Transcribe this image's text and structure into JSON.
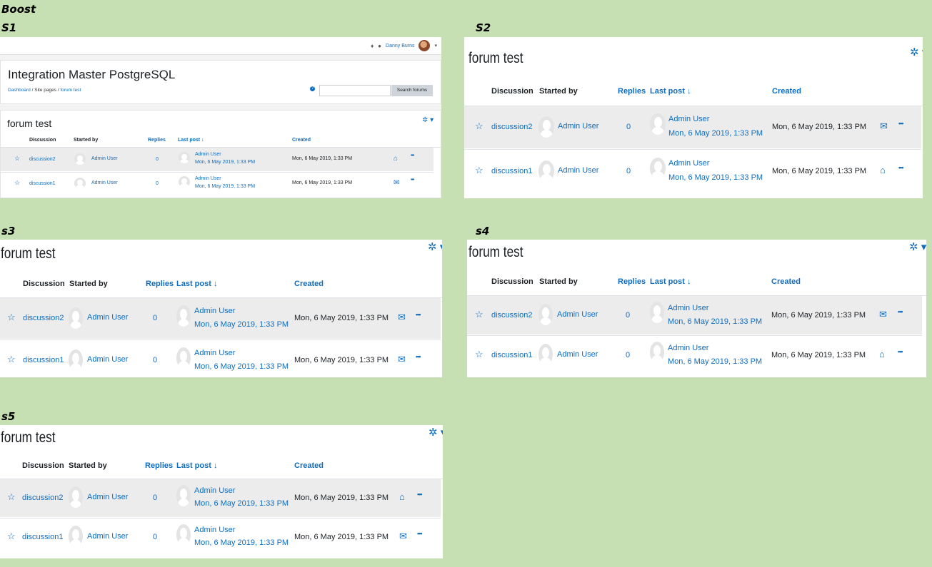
{
  "labels": {
    "boost": "Boost",
    "s1": "S1",
    "s2": "S2",
    "s3": "s3",
    "s4": "s4",
    "s5": "s5"
  },
  "navbar": {
    "user_name": "Danny Burns"
  },
  "site": {
    "title": "Integration Master PostgreSQL",
    "breadcrumb": [
      "Dashboard",
      "Site pages",
      "forum test"
    ],
    "search_button": "Search forums",
    "search_placeholder": ""
  },
  "forum": {
    "title": "forum test",
    "columns": {
      "discussion": "Discussion",
      "started_by": "Started by",
      "replies": "Replies",
      "last_post": "Last post ↓",
      "created": "Created"
    },
    "rows": [
      {
        "discussion": "discussion2",
        "started_by": "Admin User",
        "replies": "0",
        "last_post_user": "Admin User",
        "last_post_date": "Mon, 6 May 2019, 1:33 PM",
        "created": "Mon, 6 May 2019, 1:33 PM"
      },
      {
        "discussion": "discussion1",
        "started_by": "Admin User",
        "replies": "0",
        "last_post_user": "Admin User",
        "last_post_date": "Mon, 6 May 2019, 1:33 PM",
        "created": "Mon, 6 May 2019, 1:33 PM"
      }
    ]
  },
  "icons": {
    "star": "☆",
    "gear": "✲ ▾",
    "more": "•••",
    "envelope_closed": "✉",
    "envelope_open": "⌂",
    "bell": "🔔",
    "chat": "●"
  },
  "colors": {
    "background": "#c6e0b4",
    "link": "#0f6cbf",
    "row_shade": "#ececec"
  }
}
